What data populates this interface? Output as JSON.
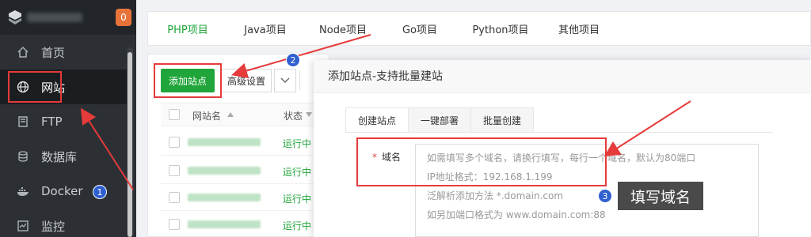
{
  "sidebar": {
    "badge_count": "0",
    "items": [
      {
        "label": "首页",
        "icon": "home-icon"
      },
      {
        "label": "网站",
        "icon": "globe-icon"
      },
      {
        "label": "FTP",
        "icon": "ftp-icon"
      },
      {
        "label": "数据库",
        "icon": "database-icon"
      },
      {
        "label": "Docker",
        "icon": "docker-icon"
      },
      {
        "label": "监控",
        "icon": "monitor-icon"
      }
    ]
  },
  "top_tabs": [
    "PHP项目",
    "Java项目",
    "Node项目",
    "Go项目",
    "Python项目",
    "其他项目"
  ],
  "toolbar": {
    "add_site_label": "添加站点",
    "advanced_label": "高级设置"
  },
  "table": {
    "headers": {
      "name": "网站名",
      "status": "状态"
    },
    "rows": [
      {
        "status": "运行中"
      },
      {
        "status": "运行中"
      },
      {
        "status": "运行中"
      },
      {
        "status": "运行中"
      }
    ]
  },
  "modal": {
    "title": "添加站点-支持批量建站",
    "tabs": [
      "创建站点",
      "一键部署",
      "批量创建"
    ],
    "domain_label": "域名",
    "required_mark": "*",
    "placeholder_lines": [
      "如需填写多个域名，请换行填写，每行一个域名，默认为80端口",
      "IP地址格式：192.168.1.199",
      "泛解析添加方法 *.domain.com",
      "如另加端口格式为 www.domain.com:88"
    ]
  },
  "annotations": {
    "badge_1": "1",
    "badge_2": "2",
    "badge_3": "3",
    "callout_text": "填写域名"
  },
  "colors": {
    "accent_green": "#20a53a",
    "sidebar_bg": "#2c3034",
    "highlight_red": "#e63b3b",
    "badge_blue": "#2f5fd0"
  }
}
